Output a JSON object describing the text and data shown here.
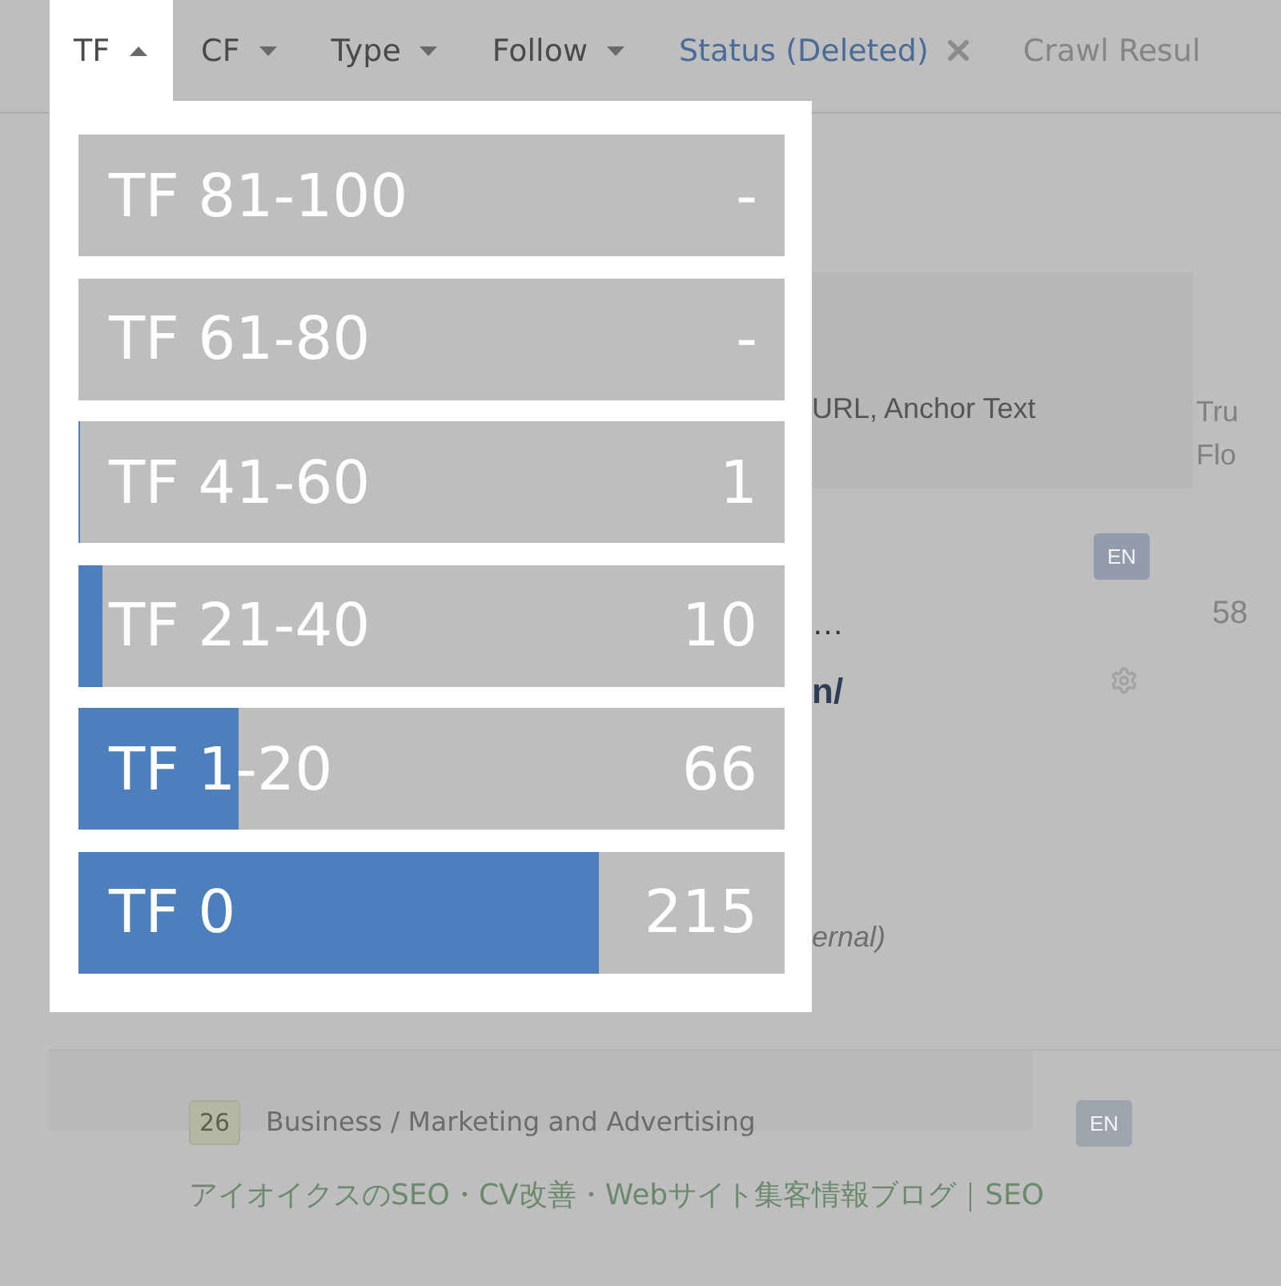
{
  "filter_bar": {
    "tabs": [
      {
        "label": "TF",
        "kind": "dropdown",
        "expanded": true
      },
      {
        "label": "CF",
        "kind": "dropdown",
        "expanded": false
      },
      {
        "label": "Type",
        "kind": "dropdown",
        "expanded": false
      },
      {
        "label": "Follow",
        "kind": "dropdown",
        "expanded": false
      },
      {
        "label": "Status (Deleted)",
        "kind": "applied"
      },
      {
        "label": "Crawl Resul",
        "kind": "muted"
      }
    ]
  },
  "tf_dropdown": {
    "options": [
      {
        "label": "TF 81-100",
        "count": "-",
        "level": 0
      },
      {
        "label": "TF 61-80",
        "count": "-",
        "level": 0
      },
      {
        "label": "TF 41-60",
        "count": "1",
        "level": 0.0034
      },
      {
        "label": "TF 21-40",
        "count": "10",
        "level": 0.0342
      },
      {
        "label": "TF 1-20",
        "count": "66",
        "level": 0.226
      },
      {
        "label": "TF 0",
        "count": "215",
        "level": 0.7363
      }
    ]
  },
  "table": {
    "header": {
      "column_2": "URL, Anchor Text",
      "column_3": [
        "Tru",
        "Flo"
      ]
    },
    "rows": [
      {
        "kind": "detail",
        "title_end": "…",
        "url_end": "n/",
        "note_end": "ernal)",
        "language": "EN",
        "score": "58"
      },
      {
        "kind": "topic",
        "topic_score": "26",
        "topic": "Business / Marketing and Advertising",
        "language": "EN",
        "title": "アイオイクスのSEO・CV改善・Webサイト集客情報ブログ｜SEO"
      }
    ]
  }
}
